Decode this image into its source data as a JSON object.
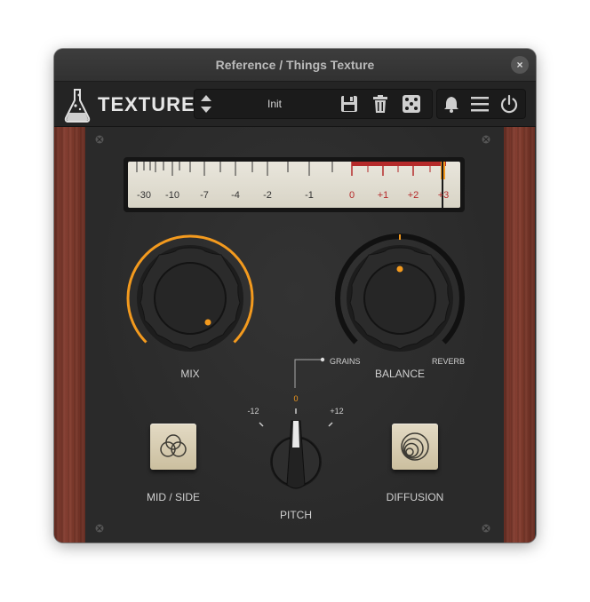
{
  "window": {
    "title": "Reference / Things Texture",
    "close_icon": "×"
  },
  "toolbar": {
    "logo_text": "TEXTURE",
    "preset_name": "Init",
    "icons": [
      "flask-icon",
      "updown-arrows-icon",
      "save-icon",
      "trash-icon",
      "dice-icon",
      "bell-icon",
      "menu-icon",
      "power-icon"
    ]
  },
  "meter": {
    "scale_labels": [
      "-30",
      "-10",
      "-7",
      "-4",
      "-2",
      "-1",
      "0",
      "+1",
      "+2",
      "+3"
    ],
    "accent_red": "#b52a2a"
  },
  "controls": {
    "mix_label": "MIX",
    "balance_label": "BALANCE",
    "balance_left": "GRAINS",
    "balance_right": "REVERB",
    "pitch_label": "PITCH",
    "pitch_center": "0",
    "pitch_min": "-12",
    "pitch_max": "+12",
    "midside_label": "MID / SIDE",
    "diffusion_label": "DIFFUSION"
  },
  "colors": {
    "accent": "#f39a1e",
    "panel": "#2c2c2c",
    "wood": "#7a3729",
    "button_face": "#d8ccaf"
  }
}
